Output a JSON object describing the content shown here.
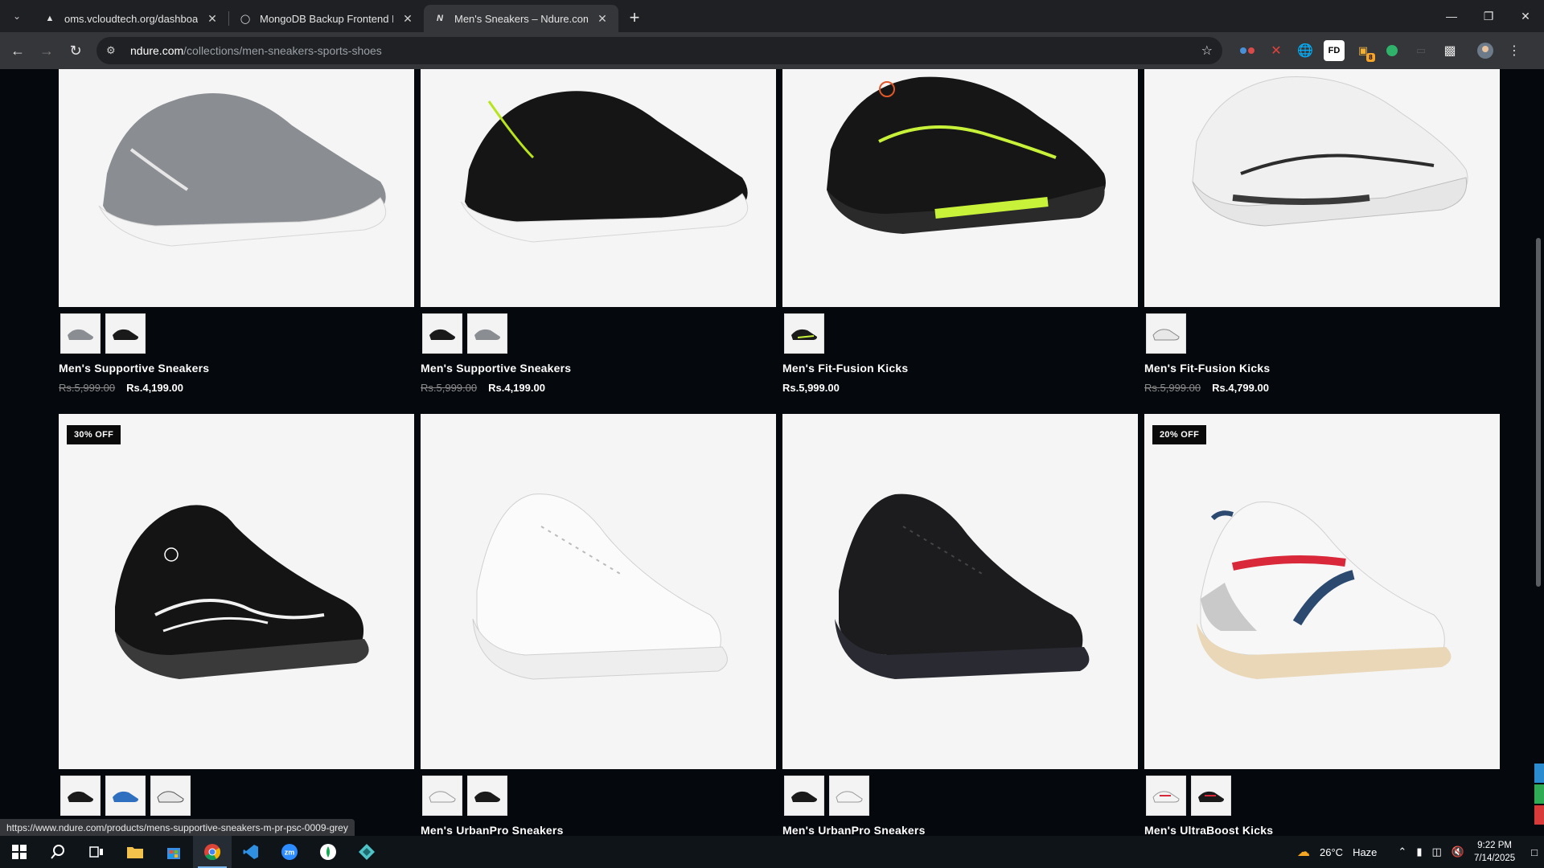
{
  "browser": {
    "tabs": [
      {
        "title": "oms.vcloudtech.org/dashboard",
        "icon": "triangle-icon",
        "active": false
      },
      {
        "title": "MongoDB Backup Frontend Int",
        "icon": "globe-icon",
        "active": false
      },
      {
        "title": "Men's Sneakers – Ndure.com",
        "icon": "ndure-logo-icon",
        "active": true
      }
    ],
    "url_host": "ndure.com",
    "url_path": "/collections/men-sneakers-sports-shoes",
    "extensions": [
      "glasses-icon",
      "close-x-icon",
      "globe-icon",
      "fd-icon",
      "folder-badge-icon",
      "leaf-icon",
      "screen-icon",
      "puzzle-icon",
      "profile-icon",
      "menu-dots-icon"
    ],
    "ext_fd_label": "FD",
    "ext_badge": "8"
  },
  "products_row1": [
    {
      "name": "Men's Supportive Sneakers",
      "old_price": "Rs.5,999.00",
      "price": "Rs.4,199.00",
      "color": "grey",
      "swatches": [
        "grey",
        "black"
      ]
    },
    {
      "name": "Men's Supportive Sneakers",
      "old_price": "Rs.5,999.00",
      "price": "Rs.4,199.00",
      "color": "black-lime",
      "swatches": [
        "black",
        "grey"
      ]
    },
    {
      "name": "Men's Fit-Fusion Kicks",
      "old_price": "",
      "price": "Rs.5,999.00",
      "color": "black-volt",
      "swatches": [
        "black-volt"
      ]
    },
    {
      "name": "Men's Fit-Fusion Kicks",
      "old_price": "Rs.5,999.00",
      "price": "Rs.4,799.00",
      "color": "white",
      "swatches": [
        "white"
      ]
    }
  ],
  "products_row2": [
    {
      "name": "",
      "badge": "30% OFF",
      "color": "black-runner",
      "swatches": [
        "black",
        "blue",
        "white"
      ]
    },
    {
      "name": "Men's UrbanPro Sneakers",
      "badge": "",
      "color": "white-court",
      "swatches": [
        "white",
        "black"
      ]
    },
    {
      "name": "Men's UrbanPro Sneakers",
      "badge": "",
      "color": "black-court",
      "swatches": [
        "black",
        "white"
      ]
    },
    {
      "name": "Men's UltraBoost Kicks",
      "badge": "20% OFF",
      "color": "white-retro",
      "swatches": [
        "white-red",
        "black-red"
      ]
    }
  ],
  "status_url": "https://www.ndure.com/products/mens-supportive-sneakers-m-pr-psc-0009-grey",
  "taskbar": {
    "apps": [
      "windows-start-icon",
      "search-icon",
      "task-view-icon",
      "file-explorer-icon",
      "store-icon",
      "chrome-icon",
      "vscode-icon",
      "zoom-icon",
      "app-green-icon",
      "app-diamond-icon"
    ],
    "weather_temp": "26°C",
    "weather_desc": "Haze",
    "time": "9:22 PM",
    "date": "7/14/2025"
  }
}
